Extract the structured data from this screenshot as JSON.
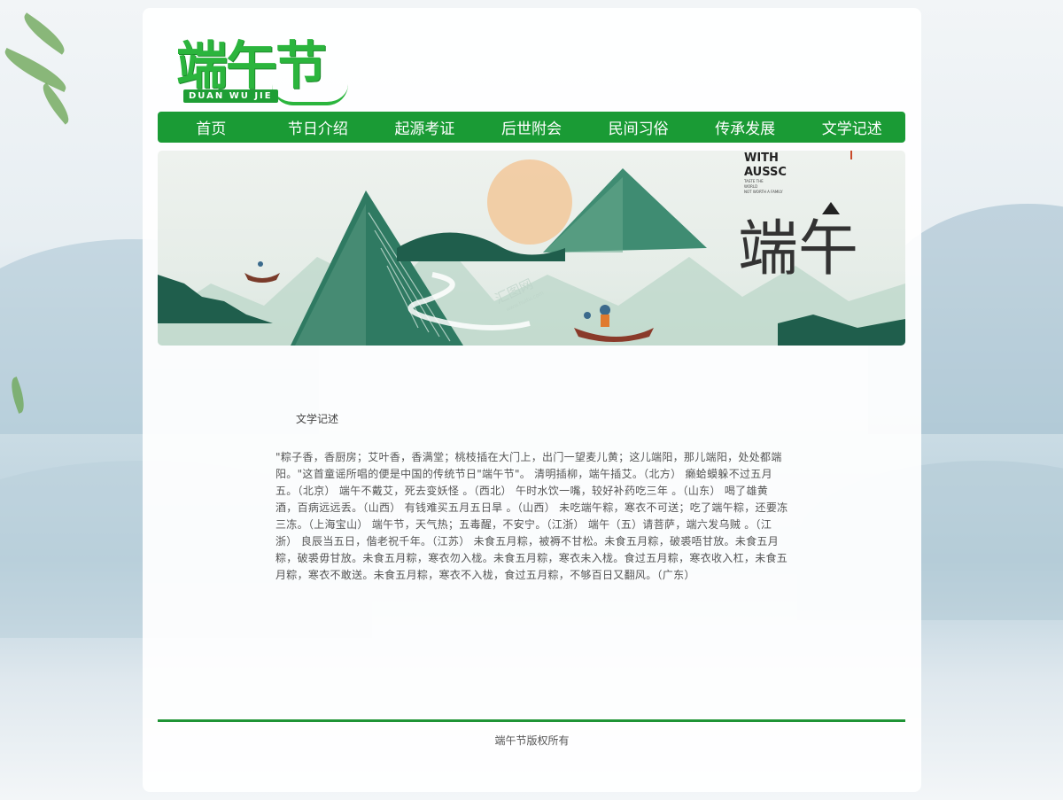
{
  "logo": {
    "title": "端午节",
    "subtitle": "DUAN WU JIE"
  },
  "nav": {
    "items": [
      {
        "label": "首页"
      },
      {
        "label": "节日介绍"
      },
      {
        "label": "起源考证"
      },
      {
        "label": "后世附会"
      },
      {
        "label": "民间习俗"
      },
      {
        "label": "传承发展"
      },
      {
        "label": "文学记述"
      }
    ]
  },
  "banner": {
    "tag_line1": "WITH",
    "tag_line2": "AUSSC",
    "tag_small1": "TASTE THE",
    "tag_small2": "WORLD",
    "tag_small3": "NOT WORTH A FAMILY",
    "calligraphy": "端午",
    "watermark": "汇图网",
    "watermark_url": "www.huitu.com"
  },
  "content": {
    "title": "文学记述",
    "body": "\"粽子香，香厨房；艾叶香，香满堂；桃枝插在大门上，出门一望麦儿黄；这儿端阳，那儿端阳，处处都端阳。\"这首童谣所唱的便是中国的传统节日\"端午节\"。 清明插柳，端午插艾。（北方） 癞蛤蟆躲不过五月五。（北京） 端午不戴艾，死去变妖怪 。（西北） 午时水饮一嘴，较好补药吃三年 。（山东） 喝了雄黄酒，百病远远丢。（山西） 有钱难买五月五日旱 。（山西） 未吃端午粽，寒衣不可送；吃了端午粽，还要冻三冻。（上海宝山） 端午节，天气热；五毒醒，不安宁。（江浙） 端午（五）请菩萨，端六发乌贼 。（江浙） 良辰当五日，偕老祝千年。（江苏） 未食五月粽，被褥不甘松。未食五月粽，破裘唔甘放。未食五月粽，破裘毋甘放。未食五月粽，寒衣勿入栊。未食五月粽，寒衣未入栊。食过五月粽，寒衣收入杠，未食五月粽，寒衣不敢送。未食五月粽，寒衣不入栊，食过五月粽，不够百日又翻风。（广东）"
  },
  "footer": {
    "copyright": "端午节版权所有"
  },
  "colors": {
    "nav_green": "#1a9b35",
    "logo_green": "#2bb53d",
    "footer_line": "#1f9435",
    "banner_dark": "#1f5e4c",
    "sun": "#f2c89a"
  }
}
